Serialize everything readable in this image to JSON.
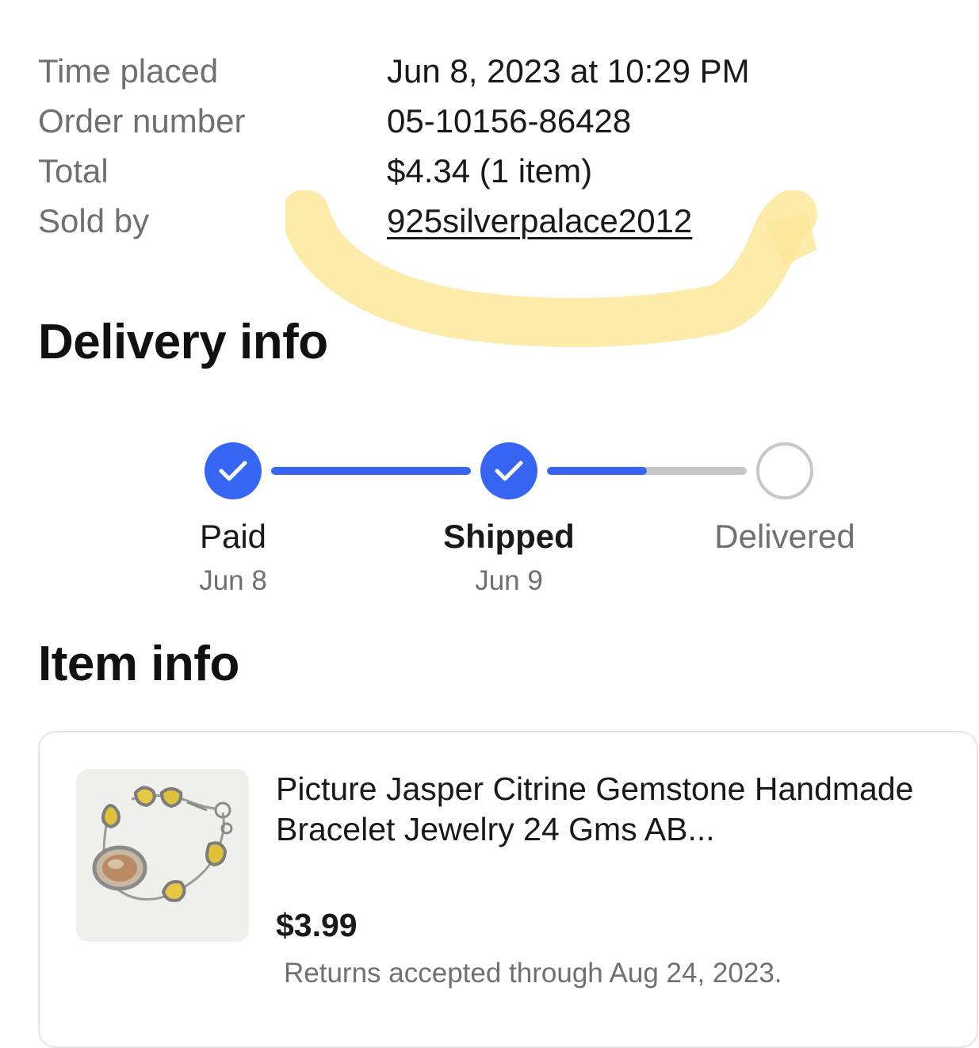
{
  "order_summary": {
    "rows": [
      {
        "label": "Time placed",
        "value": "Jun 8, 2023 at 10:29 PM"
      },
      {
        "label": "Order number",
        "value": "05-10156-86428"
      },
      {
        "label": "Total",
        "value": "$4.34 (1 item)"
      },
      {
        "label": "Sold by",
        "value": "925silverpalace2012"
      }
    ]
  },
  "delivery": {
    "title": "Delivery info",
    "steps": [
      {
        "label": "Paid",
        "date": "Jun 8",
        "status": "done"
      },
      {
        "label": "Shipped",
        "date": "Jun 9",
        "status": "current"
      },
      {
        "label": "Delivered",
        "date": "",
        "status": "pending"
      }
    ],
    "progress_to_delivered": 0.5,
    "accent_color": "#3665f3",
    "inactive_color": "#c7c7c7"
  },
  "item": {
    "section_title": "Item info",
    "name": "Picture Jasper Citrine Gemstone Handmade Bracelet Jewelry 24 Gms AB...",
    "price": "$3.99",
    "returns": "Returns accepted through Aug 24, 2023.",
    "image_icon": "bracelet-photo"
  },
  "annotation": {
    "highlight_color": "#fbe79a"
  }
}
